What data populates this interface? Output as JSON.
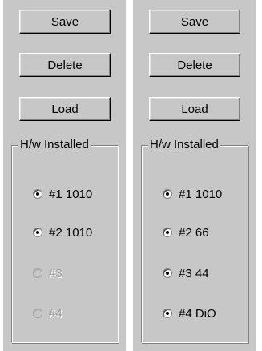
{
  "panels": [
    {
      "buttons": {
        "save": "Save",
        "delete": "Delete",
        "load": "Load"
      },
      "group_label": "H/w Installed",
      "options": [
        {
          "label": "#1 1010",
          "checked": true,
          "enabled": true
        },
        {
          "label": "#2 1010",
          "checked": true,
          "enabled": true
        },
        {
          "label": "#3",
          "checked": false,
          "enabled": false
        },
        {
          "label": "#4",
          "checked": false,
          "enabled": false
        }
      ]
    },
    {
      "buttons": {
        "save": "Save",
        "delete": "Delete",
        "load": "Load"
      },
      "group_label": "H/w Installed",
      "options": [
        {
          "label": "#1 1010",
          "checked": true,
          "enabled": true
        },
        {
          "label": "#2 66",
          "checked": true,
          "enabled": true
        },
        {
          "label": "#3 44",
          "checked": true,
          "enabled": true
        },
        {
          "label": "#4 DiO",
          "checked": true,
          "enabled": true
        }
      ]
    }
  ],
  "colors": {
    "panel_background": "#c7c7c7",
    "disabled_text": "#9a9a9a"
  }
}
